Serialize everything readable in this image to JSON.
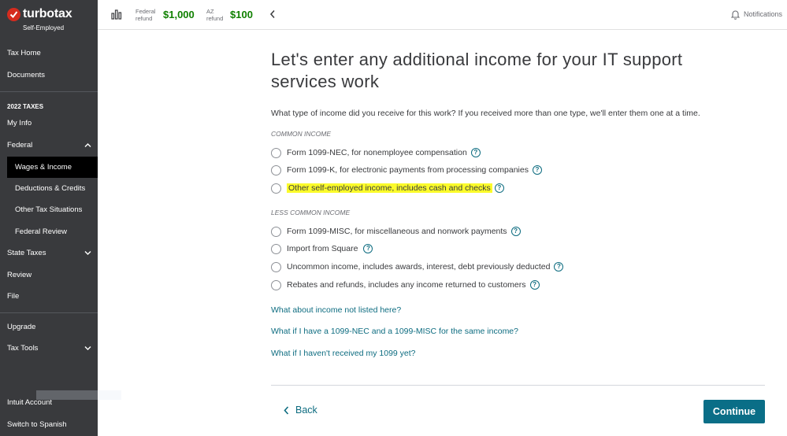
{
  "app": {
    "logo_text": "turbotax",
    "edition": "Self-Employed",
    "brand_color": "#d52b1e"
  },
  "sidebar": {
    "tax_home": "Tax Home",
    "documents": "Documents",
    "section_heading": "2022 TAXES",
    "my_info": "My Info",
    "federal": "Federal",
    "federal_items": [
      {
        "label": "Wages & Income",
        "active": true
      },
      {
        "label": "Deductions & Credits"
      },
      {
        "label": "Other Tax Situations"
      },
      {
        "label": "Federal Review"
      }
    ],
    "state_taxes": "State Taxes",
    "review": "Review",
    "file": "File",
    "upgrade": "Upgrade",
    "tax_tools": "Tax Tools",
    "intuit_account": "Intuit Account",
    "switch_spanish": "Switch to Spanish"
  },
  "topbar": {
    "federal_label_1": "Federal",
    "federal_label_2": "refund",
    "federal_amount": "$1,000",
    "state_label_1": "AZ",
    "state_label_2": "refund",
    "state_amount": "$100",
    "refund_color": "#108000",
    "notifications": "Notifications"
  },
  "main": {
    "title": "Let's enter any additional income for your IT support services work",
    "question": "What type of income did you receive for this work? If you received more than one type, we'll enter them one at a time.",
    "common_label": "COMMON INCOME",
    "common_options": [
      {
        "title": "Form 1099-NEC",
        "desc": ", for nonemployee compensation"
      },
      {
        "title": "Form 1099-K",
        "desc": ", for electronic payments from processing companies"
      },
      {
        "title": "Other self-employed income",
        "desc": ", includes cash and checks",
        "highlighted": true
      }
    ],
    "less_common_label": "LESS COMMON INCOME",
    "less_common_options": [
      {
        "title": "Form 1099-MISC",
        "desc": ", for miscellaneous and nonwork payments"
      },
      {
        "title": "Import from Square",
        "desc": ""
      },
      {
        "title": "Uncommon income",
        "desc": ", includes awards, interest, debt previously deducted"
      },
      {
        "title": "Rebates and refunds",
        "desc": ", includes any income returned to customers"
      }
    ],
    "links": [
      "What about income not listed here?",
      "What if I have a 1099-NEC and a 1099-MISC for the same income?",
      "What if I haven't received my 1099 yet?"
    ],
    "help_glyph": "?",
    "back_label": "Back",
    "continue_label": "Continue",
    "accent_color": "#0d6c80"
  }
}
